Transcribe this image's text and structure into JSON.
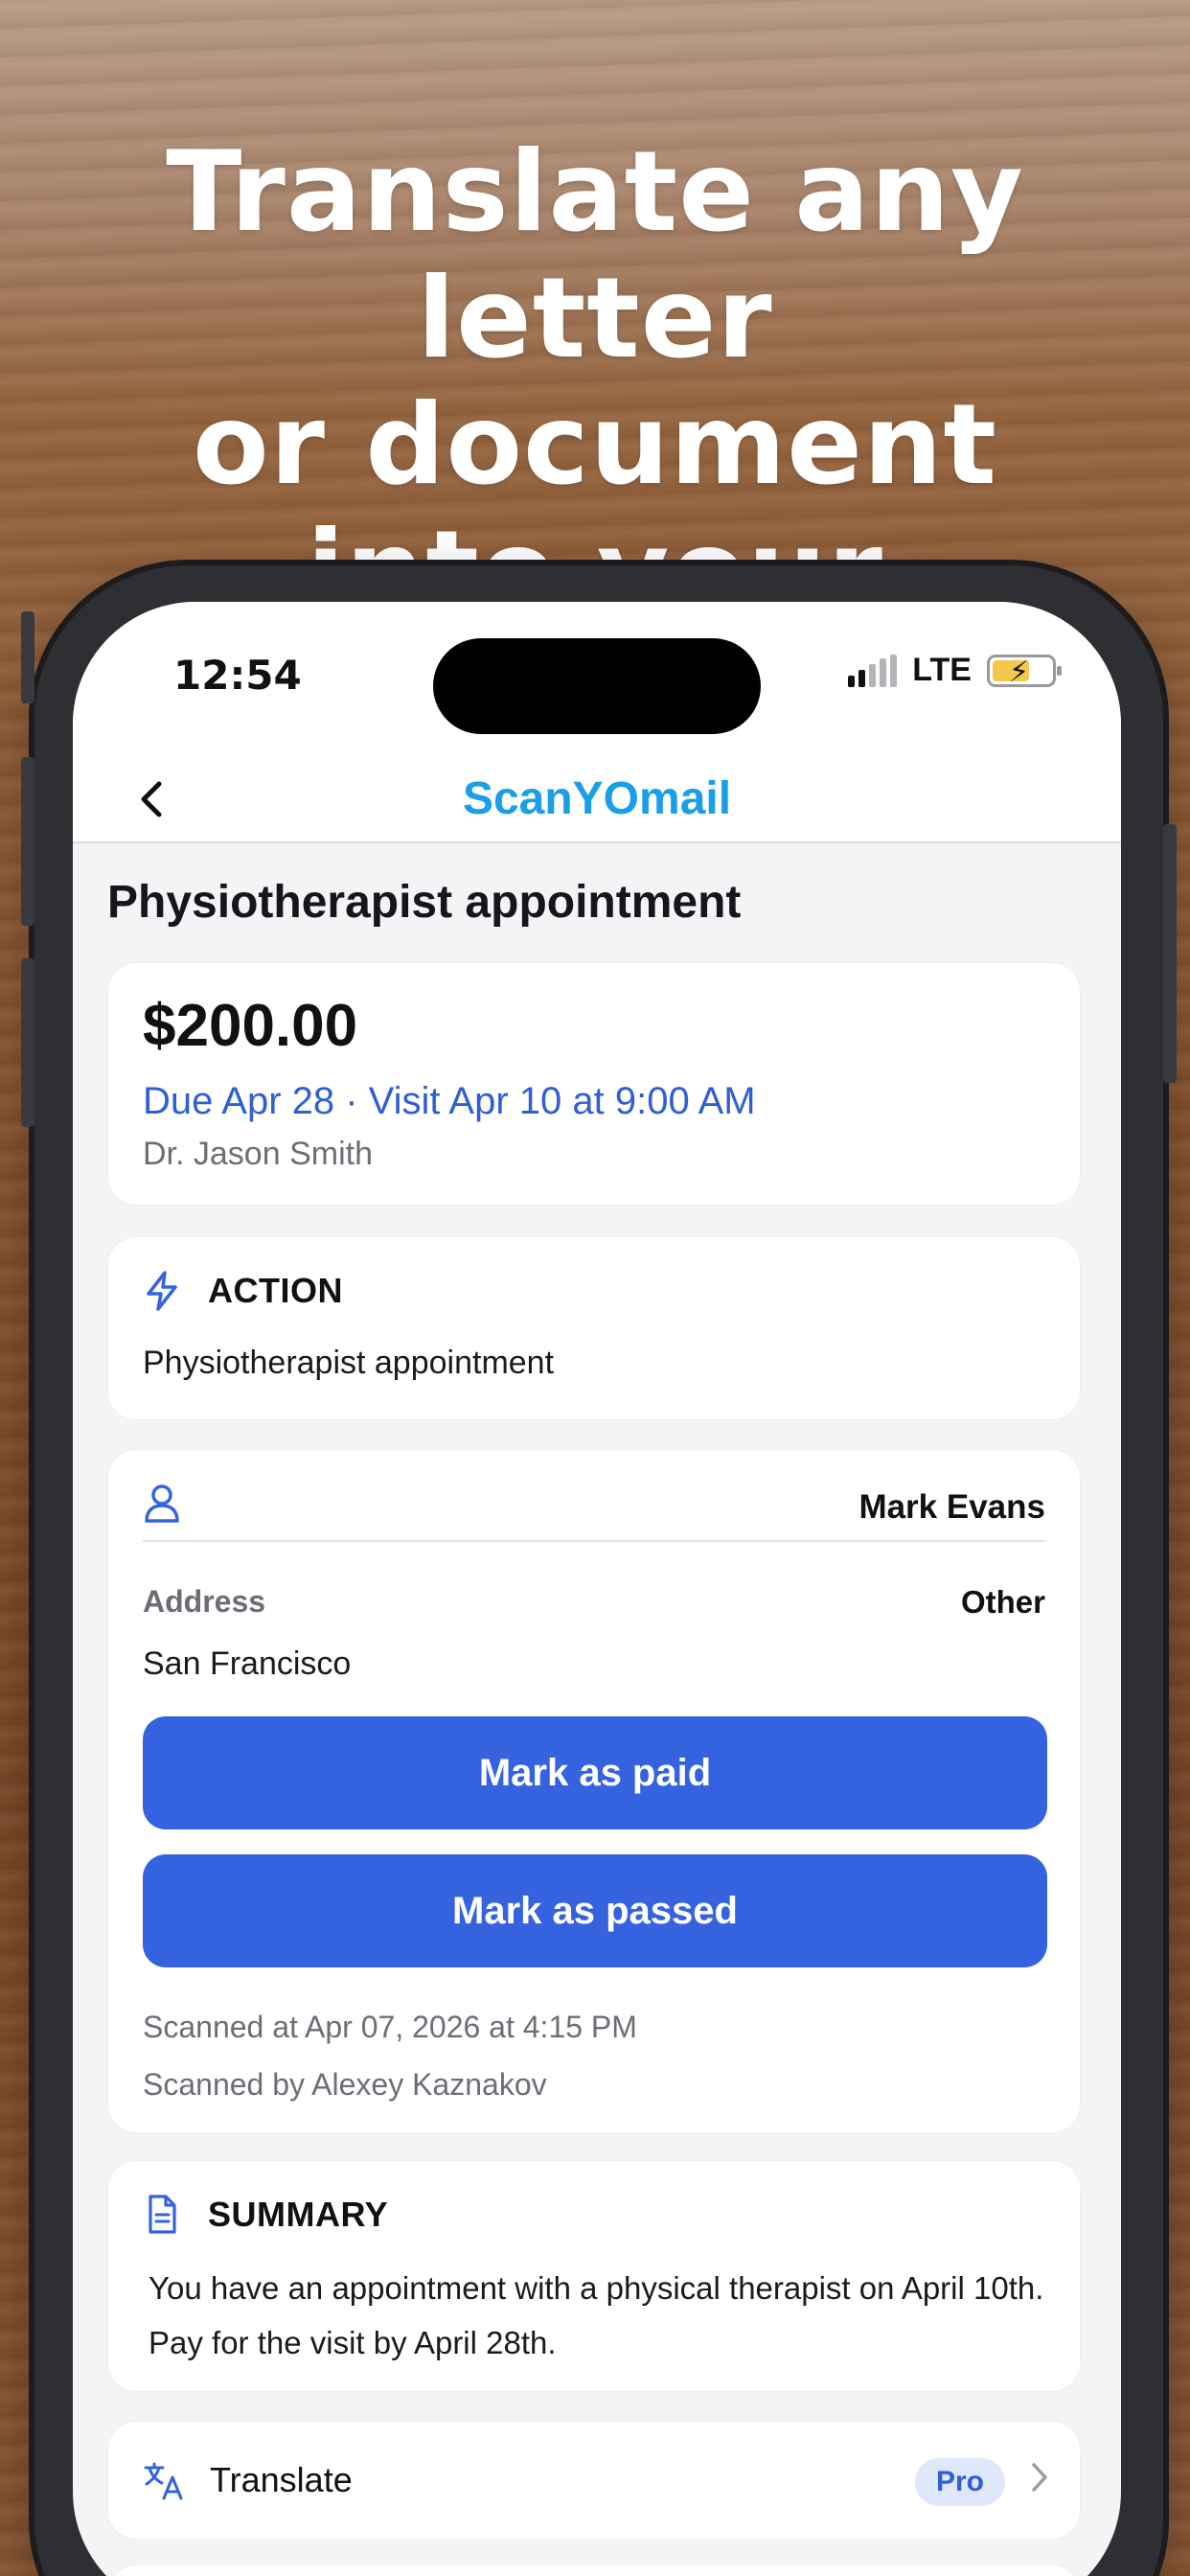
{
  "headline": "Translate any letter\nor document\ninto your language",
  "status_bar": {
    "time": "12:54",
    "network": "LTE"
  },
  "nav": {
    "back_icon": "chevron-left-icon",
    "title": "ScanYOmail"
  },
  "document": {
    "title": "Physiotherapist appointment",
    "amount": "$200.00",
    "due_line": "Due Apr 28 · Visit Apr 10 at 9:00 AM",
    "doctor": "Dr. Jason Smith"
  },
  "action": {
    "icon": "lightning-icon",
    "label": "ACTION",
    "text": "Physiotherapist appointment"
  },
  "recipient": {
    "icon": "person-icon",
    "name": "Mark Evans",
    "address_label": "Address",
    "address_type": "Other",
    "address_value": "San Francisco",
    "mark_paid_label": "Mark as paid",
    "mark_passed_label": "Mark as passed",
    "scanned_at": "Scanned at Apr 07, 2026 at 4:15 PM",
    "scanned_by": "Scanned by Alexey Kaznakov"
  },
  "summary": {
    "icon": "document-icon",
    "label": "SUMMARY",
    "text": "You have an appointment with a physical therapist on April 10th. Pay for the visit by April 28th."
  },
  "translate": {
    "icon": "translate-icon",
    "label": "Translate",
    "badge": "Pro"
  },
  "colors": {
    "accent": "#3563e0",
    "brand_title": "#1a9ee8",
    "link_blue": "#2f5fd6"
  }
}
